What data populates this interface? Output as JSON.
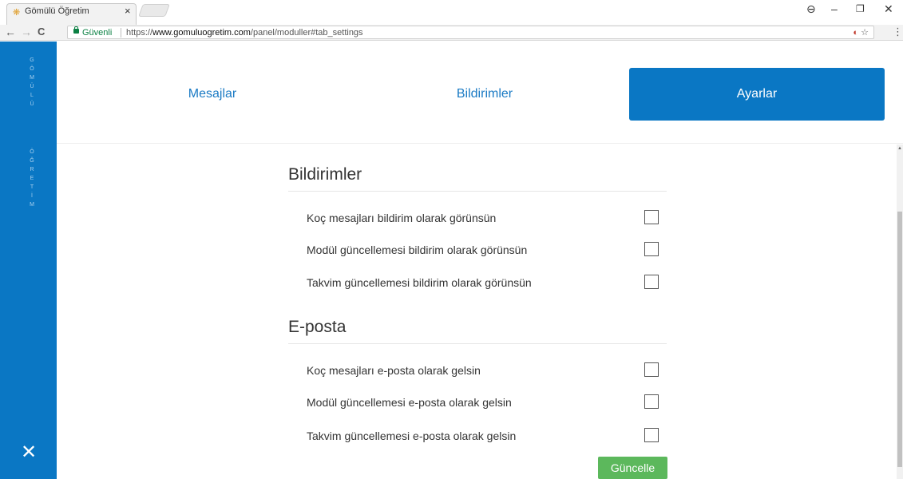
{
  "browser": {
    "tab_title": "Gömülü Öğretim",
    "tab_close": "×",
    "secure_label": "Güvenli",
    "url_scheme": "https://",
    "url_host": "www.gomuluogretim.com",
    "url_path": "/panel/moduller#tab_settings",
    "back_icon": "←",
    "forward_icon": "→",
    "reload_icon": "C",
    "account_icon": "⊖",
    "minimize_icon": "–",
    "restore_icon": "❐",
    "close_window_icon": "✕",
    "star_icon": "☆",
    "menu_icon": "⋮"
  },
  "sidebar": {
    "brand_word1": [
      "G",
      "Ö",
      "M",
      "Ü",
      "L",
      "Ü"
    ],
    "brand_word2": [
      "Ö",
      "Ğ",
      "R",
      "E",
      "T",
      "İ",
      "M"
    ],
    "close_icon": "✕",
    "color": "#0a77c4"
  },
  "tabs": [
    {
      "label": "Mesajlar",
      "active": false
    },
    {
      "label": "Bildirimler",
      "active": false
    },
    {
      "label": "Ayarlar",
      "active": true
    }
  ],
  "sections": [
    {
      "title": "Bildirimler",
      "options": [
        {
          "label": "Koç mesajları bildirim olarak görünsün",
          "checked": false
        },
        {
          "label": "Modül güncellemesi bildirim olarak görünsün",
          "checked": false
        },
        {
          "label": "Takvim güncellemesi bildirim olarak görünsün",
          "checked": false
        }
      ]
    },
    {
      "title": "E-posta",
      "options": [
        {
          "label": "Koç mesajları e-posta olarak gelsin",
          "checked": false
        },
        {
          "label": "Modül güncellemesi e-posta olarak gelsin",
          "checked": false
        },
        {
          "label": "Takvim güncellemesi e-posta olarak gelsin",
          "checked": false
        }
      ]
    }
  ],
  "update_button": {
    "label": "Güncelle",
    "color": "#5cb85c"
  },
  "accent_color": "#0a77c4"
}
